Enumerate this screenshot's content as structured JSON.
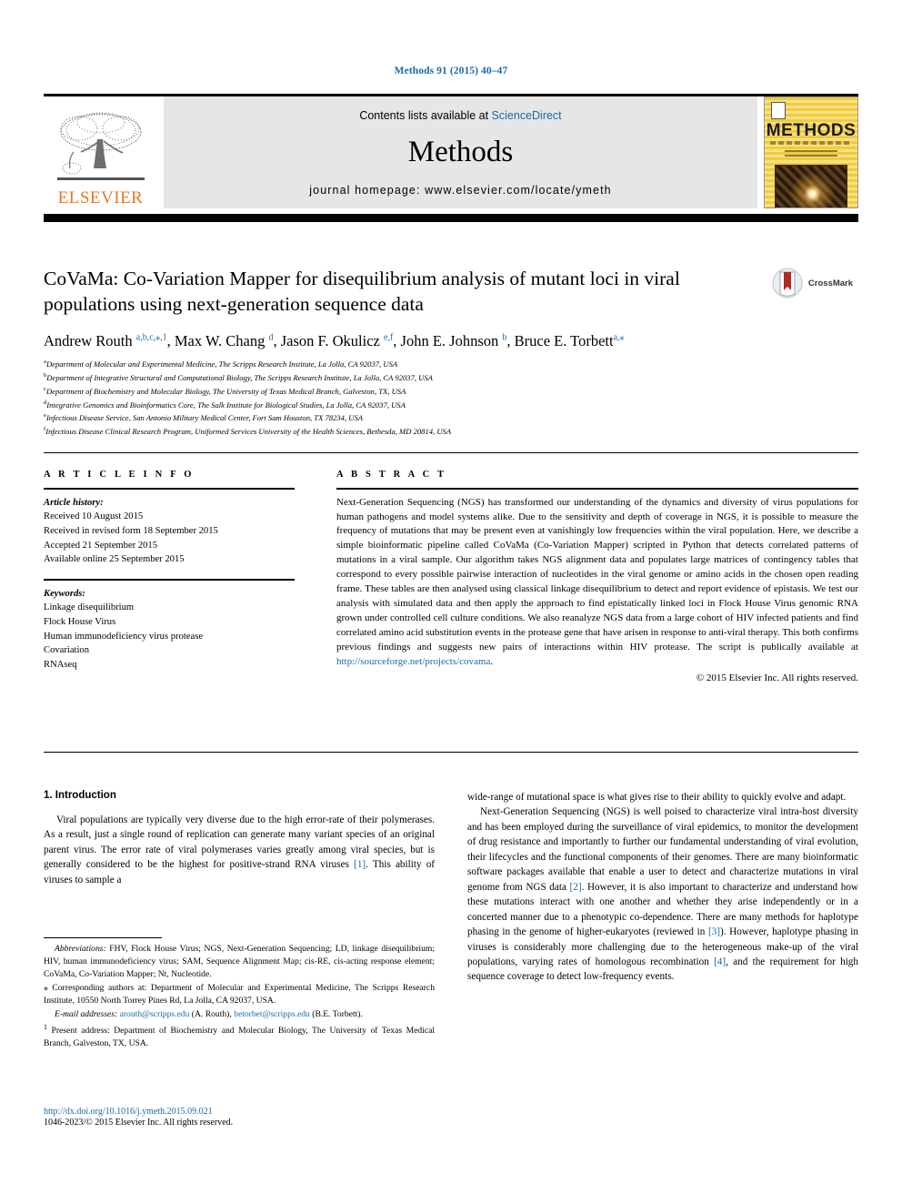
{
  "running_head": "Methods 91 (2015) 40–47",
  "banner": {
    "contents_prefix": "Contents lists available at ",
    "sciencedirect": "ScienceDirect",
    "journal_name": "Methods",
    "homepage": "journal homepage: www.elsevier.com/locate/ymeth",
    "publisher": "ELSEVIER",
    "cover_title": "METHODS"
  },
  "article": {
    "title": "CoVaMa: Co-Variation Mapper for disequilibrium analysis of mutant loci in viral populations using next-generation sequence data",
    "crossmark_label": "CrossMark",
    "authors_html": "Andrew Routh <sup>a,b,c,</sup><sup>⁎</sup><sup>,1</sup>, Max W. Chang <sup>d</sup>, Jason F. Okulicz <sup>e,f</sup>, John E. Johnson <sup>b</sup>, Bruce E. Torbett<sup>a,</sup><sup>⁎</sup>",
    "affiliations": [
      {
        "marker": "a",
        "text": "Department of Molecular and Experimental Medicine, The Scripps Research Institute, La Jolla, CA 92037, USA"
      },
      {
        "marker": "b",
        "text": "Department of Integrative Structural and Computational Biology, The Scripps Research Institute, La Jolla, CA 92037, USA"
      },
      {
        "marker": "c",
        "text": "Department of Biochemistry and Molecular Biology, The University of Texas Medical Branch, Galveston, TX, USA"
      },
      {
        "marker": "d",
        "text": "Integrative Genomics and Bioinformatics Core, The Salk Institute for Biological Studies, La Jolla, CA 92037, USA"
      },
      {
        "marker": "e",
        "text": "Infectious Disease Service, San Antonio Military Medical Center, Fort Sam Houston, TX 78234, USA"
      },
      {
        "marker": "f",
        "text": "Infectious Disease Clinical Research Program, Uniformed Services University of the Health Sciences, Bethesda, MD 20814, USA"
      }
    ]
  },
  "article_info": {
    "heading": "A R T I C L E    I N F O",
    "history_label": "Article history:",
    "history": [
      "Received 10 August 2015",
      "Received in revised form 18 September 2015",
      "Accepted 21 September 2015",
      "Available online 25 September 2015"
    ],
    "keywords_label": "Keywords:",
    "keywords": [
      "Linkage disequilibrium",
      "Flock House Virus",
      "Human immunodeficiency virus protease",
      "Covariation",
      "RNAseq"
    ]
  },
  "abstract": {
    "heading": "A B S T R A C T",
    "text_before_link": "Next-Generation Sequencing (NGS) has transformed our understanding of the dynamics and diversity of virus populations for human pathogens and model systems alike. Due to the sensitivity and depth of coverage in NGS, it is possible to measure the frequency of mutations that may be present even at vanishingly low frequencies within the viral population. Here, we describe a simple bioinformatic pipeline called CoVaMa (Co-Variation Mapper) scripted in Python that detects correlated patterns of mutations in a viral sample. Our algorithm takes NGS alignment data and populates large matrices of contingency tables that correspond to every possible pairwise interaction of nucleotides in the viral genome or amino acids in the chosen open reading frame. These tables are then analysed using classical linkage disequilibrium to detect and report evidence of epistasis. We test our analysis with simulated data and then apply the approach to find epistatically linked loci in Flock House Virus genomic RNA grown under controlled cell culture conditions. We also reanalyze NGS data from a large cohort of HIV infected patients and find correlated amino acid substitution events in the protease gene that have arisen in response to anti-viral therapy. This both confirms previous findings and suggests new pairs of interactions within HIV protease. The script is publically available at ",
    "link": "http://sourceforge.net/projects/covama",
    "text_after_link": ".",
    "copyright": "© 2015 Elsevier Inc. All rights reserved."
  },
  "body": {
    "section_number_title": "1. Introduction",
    "left_paragraph_1_a": "Viral populations are typically very diverse due to the high error-rate of their polymerases. As a result, just a single round of replication can generate many variant species of an original parent virus. The error rate of viral polymerases varies greatly among viral species, but is generally considered to be the highest for positive-strand RNA viruses ",
    "left_ref_1": "[1]",
    "left_paragraph_1_b": ". This ability of viruses to sample a",
    "right_paragraph_1": "wide-range of mutational space is what gives rise to their ability to quickly evolve and adapt.",
    "right_paragraph_2_a": "Next-Generation Sequencing (NGS) is well poised to characterize viral intra-host diversity and has been employed during the surveillance of viral epidemics, to monitor the development of drug resistance and importantly to further our fundamental understanding of viral evolution, their lifecycles and the functional components of their genomes. There are many bioinformatic software packages available that enable a user to detect and characterize mutations in viral genome from NGS data ",
    "right_ref_2": "[2]",
    "right_paragraph_2_b": ". However, it is also important to characterize and understand how these mutations interact with one another and whether they arise independently or in a concerted manner due to a phenotypic co-dependence. There are many methods for haplotype phasing in the genome of higher-eukaryotes (reviewed in ",
    "right_ref_3": "[3]",
    "right_paragraph_2_c": "). However, haplotype phasing in viruses is considerably more challenging due to the heterogeneous make-up of the viral populations, varying rates of homologous recombination ",
    "right_ref_4": "[4]",
    "right_paragraph_2_d": ", and the requirement for high sequence coverage to detect low-frequency events."
  },
  "footnotes": {
    "abbrev_label": "Abbreviations:",
    "abbrev_text": " FHV, Flock House Virus; NGS, Next-Generation Sequencing; LD, linkage disequilibrium; HIV, human immunodeficiency virus; SAM, Sequence Alignment Map; cis-RE, cis-acting response element; CoVaMa, Co-Variation Mapper; Nt, Nucleotide.",
    "corresponding_marker": "⁎",
    "corresponding_text": " Corresponding authors at: Department of Molecular and Experimental Medicine, The Scripps Research Institute, 10550 North Torrey Pines Rd, La Jolla, CA 92037, USA.",
    "email_label": "E-mail addresses:",
    "email_1": "arouth@scripps.edu",
    "email_1_owner": " (A. Routh), ",
    "email_2": "betorbet@scripps.edu",
    "email_2_owner": " (B.E. Torbett).",
    "present_marker": "1",
    "present_text": " Present address: Department of Biochemistry and Molecular Biology, The University of Texas Medical Branch, Galveston, TX, USA."
  },
  "footer": {
    "doi": "http://dx.doi.org/10.1016/j.ymeth.2015.09.021",
    "issn_copyright": "1046-2023/© 2015 Elsevier Inc. All rights reserved."
  },
  "colors": {
    "link_blue": "#1a6aa5",
    "elsevier_orange": "#E87722",
    "banner_gray": "#e6e6e6"
  }
}
